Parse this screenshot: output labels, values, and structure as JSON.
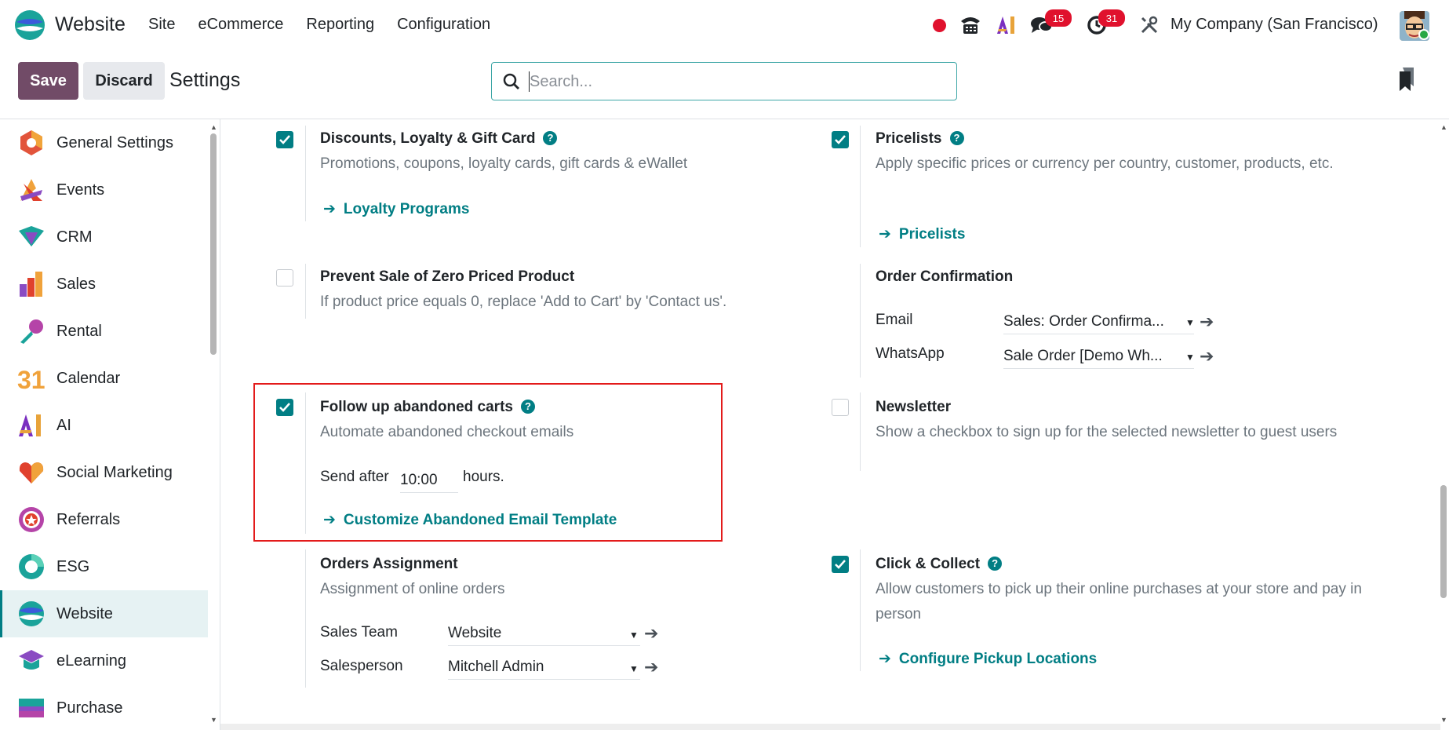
{
  "navbar": {
    "app_title": "Website",
    "menu": [
      "Site",
      "eCommerce",
      "Reporting",
      "Configuration"
    ],
    "messages_badge": "15",
    "activities_badge": "31",
    "company": "My Company (San Francisco)",
    "colors": {
      "recording_dot": "#e0112d",
      "badge": "#e0112d"
    }
  },
  "control_panel": {
    "save_label": "Save",
    "discard_label": "Discard",
    "title": "Settings",
    "search_placeholder": "Search..."
  },
  "sidebar": {
    "items": [
      {
        "label": "General Settings",
        "icon": "general-settings-icon"
      },
      {
        "label": "Events",
        "icon": "events-icon"
      },
      {
        "label": "CRM",
        "icon": "crm-icon"
      },
      {
        "label": "Sales",
        "icon": "sales-icon"
      },
      {
        "label": "Rental",
        "icon": "rental-icon"
      },
      {
        "label": "Calendar",
        "icon": "calendar-icon",
        "icon_text": "31"
      },
      {
        "label": "AI",
        "icon": "ai-icon"
      },
      {
        "label": "Social Marketing",
        "icon": "social-marketing-icon"
      },
      {
        "label": "Referrals",
        "icon": "referrals-icon"
      },
      {
        "label": "ESG",
        "icon": "esg-icon"
      },
      {
        "label": "Website",
        "icon": "website-icon",
        "active": true
      },
      {
        "label": "eLearning",
        "icon": "elearning-icon"
      },
      {
        "label": "Purchase",
        "icon": "purchase-icon"
      }
    ]
  },
  "settings": {
    "discounts": {
      "checked": true,
      "title": "Discounts, Loyalty & Gift Card",
      "description": "Promotions, coupons, loyalty cards, gift cards & eWallet",
      "link": "Loyalty Programs"
    },
    "pricelists": {
      "checked": true,
      "title": "Pricelists",
      "description": "Apply specific prices or currency per country, customer, products, etc.",
      "link": "Pricelists"
    },
    "zero_price": {
      "checked": false,
      "title": "Prevent Sale of Zero Priced Product",
      "description": "If product price equals 0, replace 'Add to Cart' by 'Contact us'."
    },
    "order_confirmation": {
      "title": "Order Confirmation",
      "email_label": "Email",
      "email_value": "Sales: Order Confirma...",
      "whatsapp_label": "WhatsApp",
      "whatsapp_value": "Sale Order [Demo Wh..."
    },
    "abandoned_carts": {
      "checked": true,
      "title": "Follow up abandoned carts",
      "description": "Automate abandoned checkout emails",
      "send_after_label": "Send after",
      "send_after_value": "10:00",
      "hours_label": "hours.",
      "link": "Customize Abandoned Email Template"
    },
    "newsletter": {
      "checked": false,
      "title": "Newsletter",
      "description": "Show a checkbox to sign up for the selected newsletter to guest users"
    },
    "orders_assignment": {
      "title": "Orders Assignment",
      "description": "Assignment of online orders",
      "sales_team_label": "Sales Team",
      "sales_team_value": "Website",
      "salesperson_label": "Salesperson",
      "salesperson_value": "Mitchell Admin"
    },
    "click_collect": {
      "checked": true,
      "title": "Click & Collect",
      "description": "Allow customers to pick up their online purchases at your store and pay in person",
      "link": "Configure Pickup Locations"
    }
  },
  "colors": {
    "primary": "#714b67",
    "teal": "#017e84",
    "highlight_box": "#e31b1b"
  }
}
